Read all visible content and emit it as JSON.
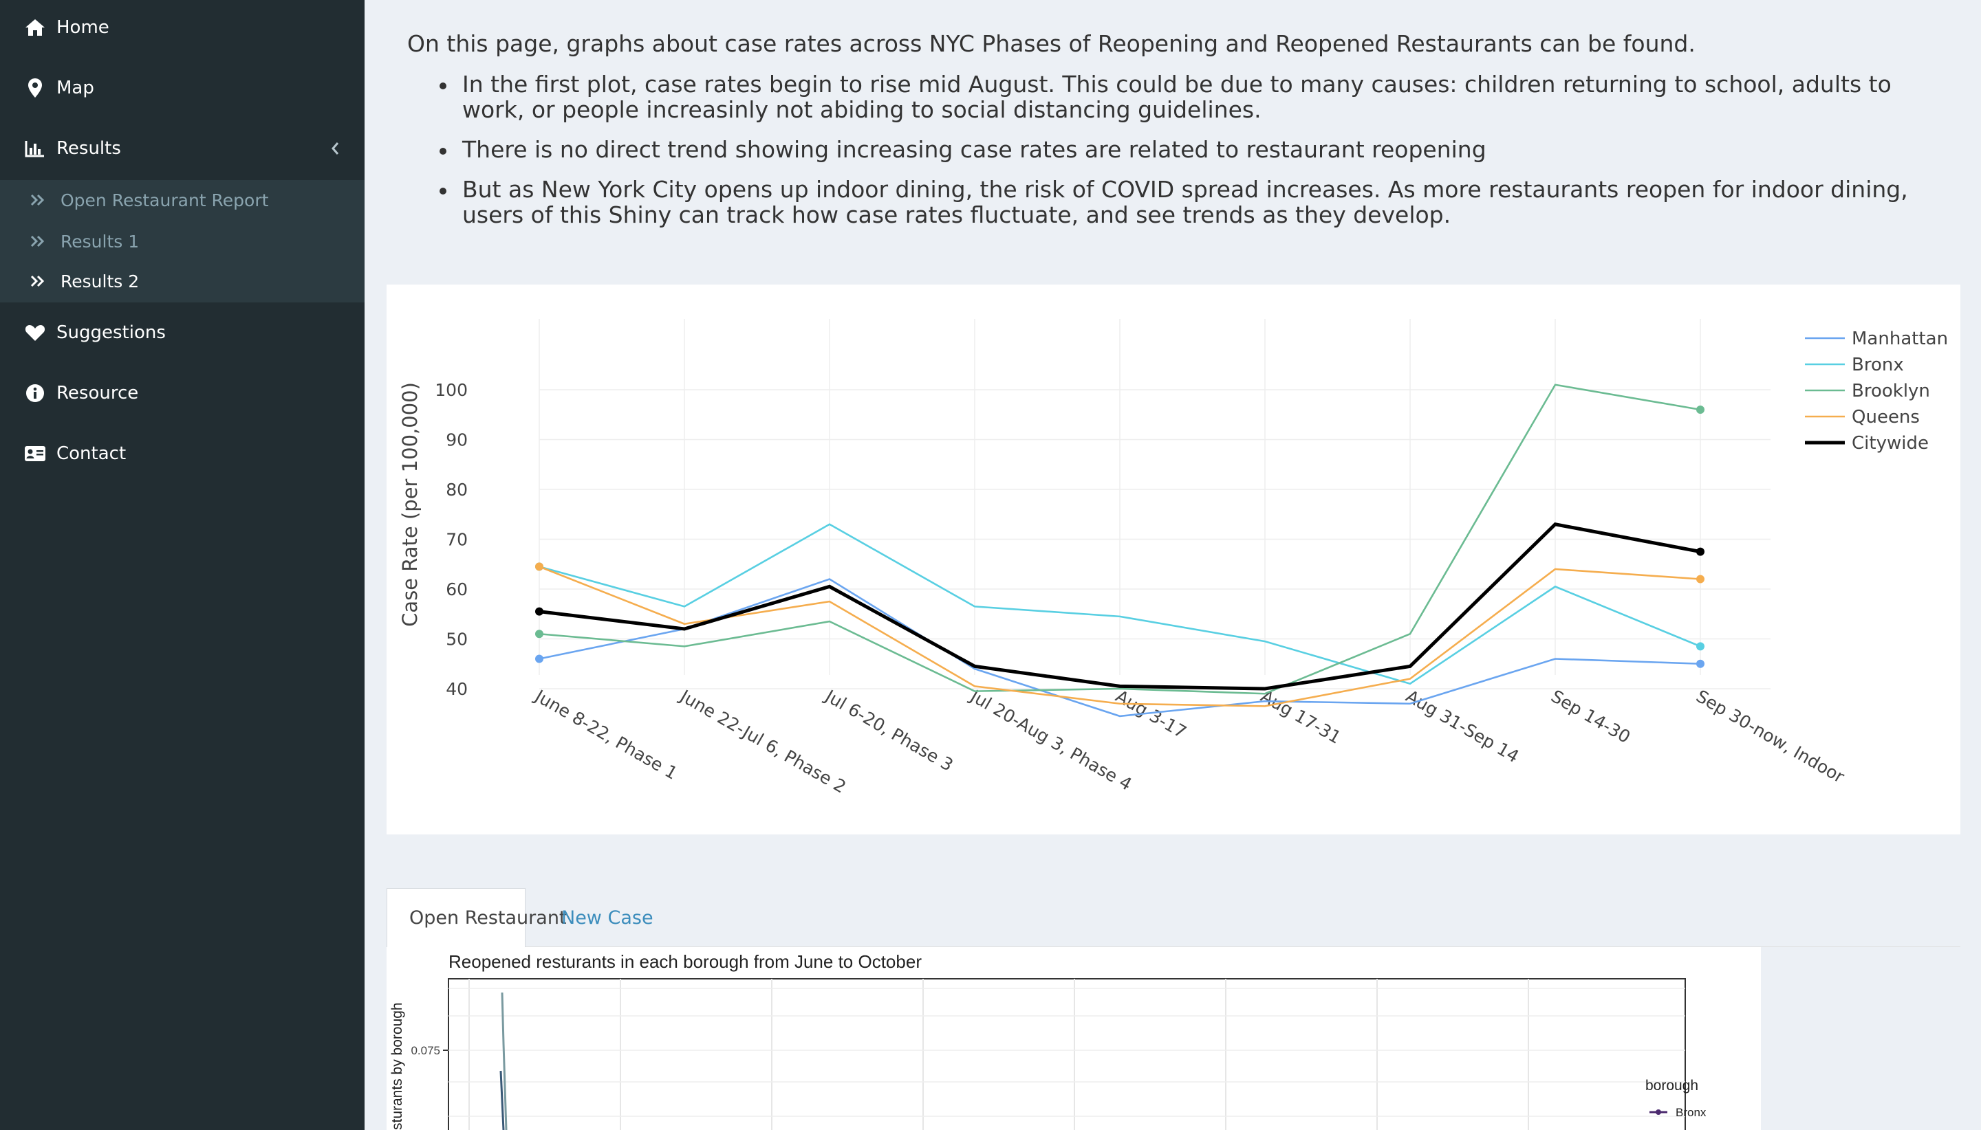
{
  "sidebar": {
    "items": [
      {
        "label": "Home",
        "icon": "home-icon"
      },
      {
        "label": "Map",
        "icon": "map-marker-icon"
      },
      {
        "label": "Results",
        "icon": "bar-chart-icon"
      },
      {
        "label": "Suggestions",
        "icon": "heart-icon"
      },
      {
        "label": "Resource",
        "icon": "info-circle-icon"
      },
      {
        "label": "Contact",
        "icon": "address-card-icon"
      }
    ],
    "results_submenu": [
      {
        "label": "Open Restaurant Report",
        "icon": "double-chevron-right-icon"
      },
      {
        "label": "Results 1",
        "icon": "double-chevron-right-icon"
      },
      {
        "label": "Results 2",
        "icon": "double-chevron-right-icon",
        "active": true
      }
    ]
  },
  "intro": {
    "text": "On this page, graphs about case rates across NYC Phases of Reopening and Reopened Restaurants can be found.",
    "bullets": [
      "In the first plot, case rates begin to rise mid August. This could be due to many causes: children returning to school, adults to work, or people increasinly not abiding to social distancing guidelines.",
      "There is no direct trend showing increasing case rates are related to restaurant reopening",
      "But as New York City opens up indoor dining, the risk of COVID spread increases. As more restaurants reopen for indoor dining, users of this Shiny can track how case rates fluctuate, and see trends as they develop."
    ]
  },
  "chart_data": [
    {
      "type": "line",
      "ylabel": "Case Rate (per 100,000)",
      "yticks": [
        40,
        50,
        60,
        70,
        80,
        90,
        100
      ],
      "ylim": [
        33,
        102
      ],
      "grid": true,
      "legend_position": "top-right",
      "categories": [
        "June 8-22, Phase 1",
        "June 22-Jul 6, Phase 2",
        "Jul 6-20, Phase 3",
        "Jul 20-Aug 3, Phase 4",
        "Aug 3-17",
        "Aug 17-31",
        "Aug 31-Sep 14",
        "Sep 14-30",
        "Sep 30-now, Indoor"
      ],
      "series": [
        {
          "name": "Manhattan",
          "color": "#6aa5f0",
          "values": [
            46,
            52,
            62,
            44,
            34.5,
            37.5,
            37,
            46,
            45
          ]
        },
        {
          "name": "Bronx",
          "color": "#58cfe2",
          "values": [
            64.5,
            56.5,
            73,
            56.5,
            54.5,
            49.5,
            41,
            60.5,
            48.5
          ]
        },
        {
          "name": "Brooklyn",
          "color": "#6bbb92",
          "values": [
            51,
            48.5,
            53.5,
            39.5,
            40,
            39,
            51,
            101,
            96
          ]
        },
        {
          "name": "Queens",
          "color": "#f5ad4e",
          "values": [
            64.5,
            53,
            57.5,
            40.5,
            37,
            36.5,
            42,
            64,
            62
          ]
        },
        {
          "name": "Citywide",
          "color": "#000000",
          "values": [
            55.5,
            52,
            60.5,
            44.5,
            40.5,
            40,
            44.5,
            73,
            67.5
          ]
        }
      ]
    },
    {
      "type": "line",
      "title": "Reopened resturants in each borough from June to October",
      "ylabel": "sturants by borough",
      "yticks": [
        "0.075"
      ],
      "legend_title": "borough",
      "legend_entries": [
        "Bronx"
      ]
    }
  ],
  "tabs": [
    {
      "label": "Open Restaurant",
      "active": true
    },
    {
      "label": "New Case",
      "active": false
    }
  ]
}
